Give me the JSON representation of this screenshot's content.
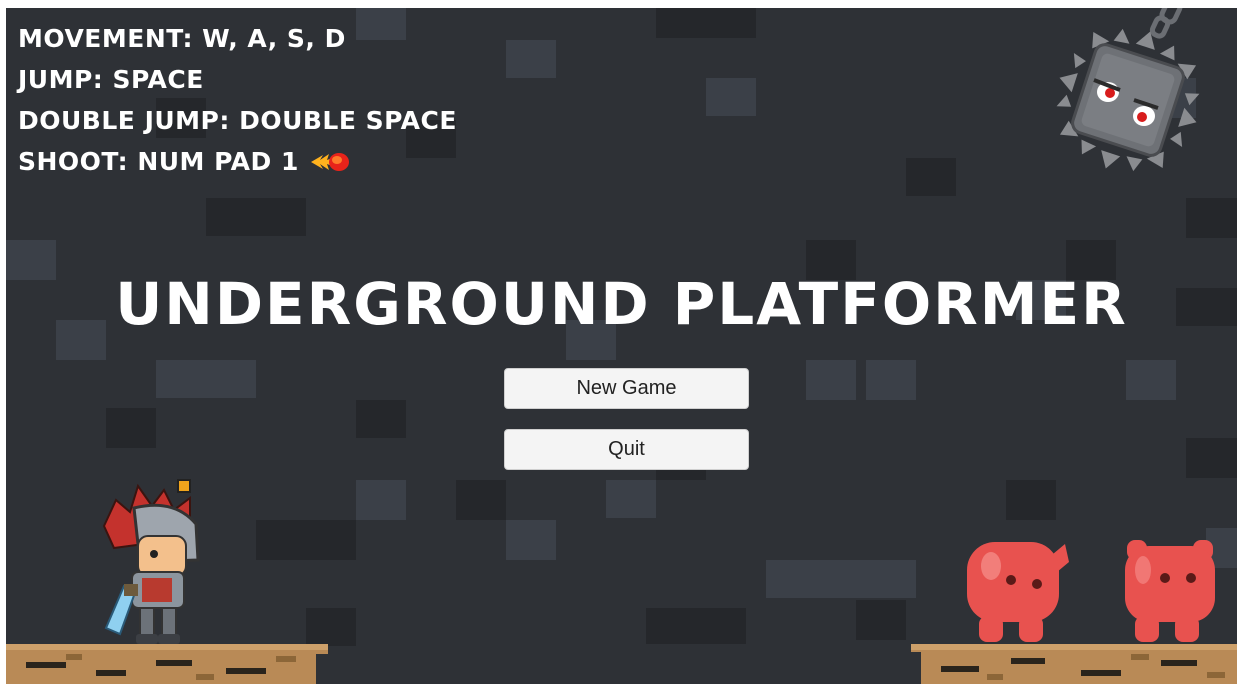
{
  "controls": {
    "movement": "MOVEMENT: W, A, S, D",
    "jump": "JUMP: SPACE",
    "double_jump": "DOUBLE JUMP: DOUBLE SPACE",
    "shoot": "SHOOT: NUM PAD 1"
  },
  "title": "UNDERGROUND PLATFORMER",
  "menu": {
    "new_game_label": "New Game",
    "quit_label": "Quit"
  },
  "colors": {
    "background": "#2e3136",
    "tile_light": "#3b4048",
    "tile_dark": "#25272b",
    "ground": "#b98a56",
    "enemy": "#e8524f"
  }
}
